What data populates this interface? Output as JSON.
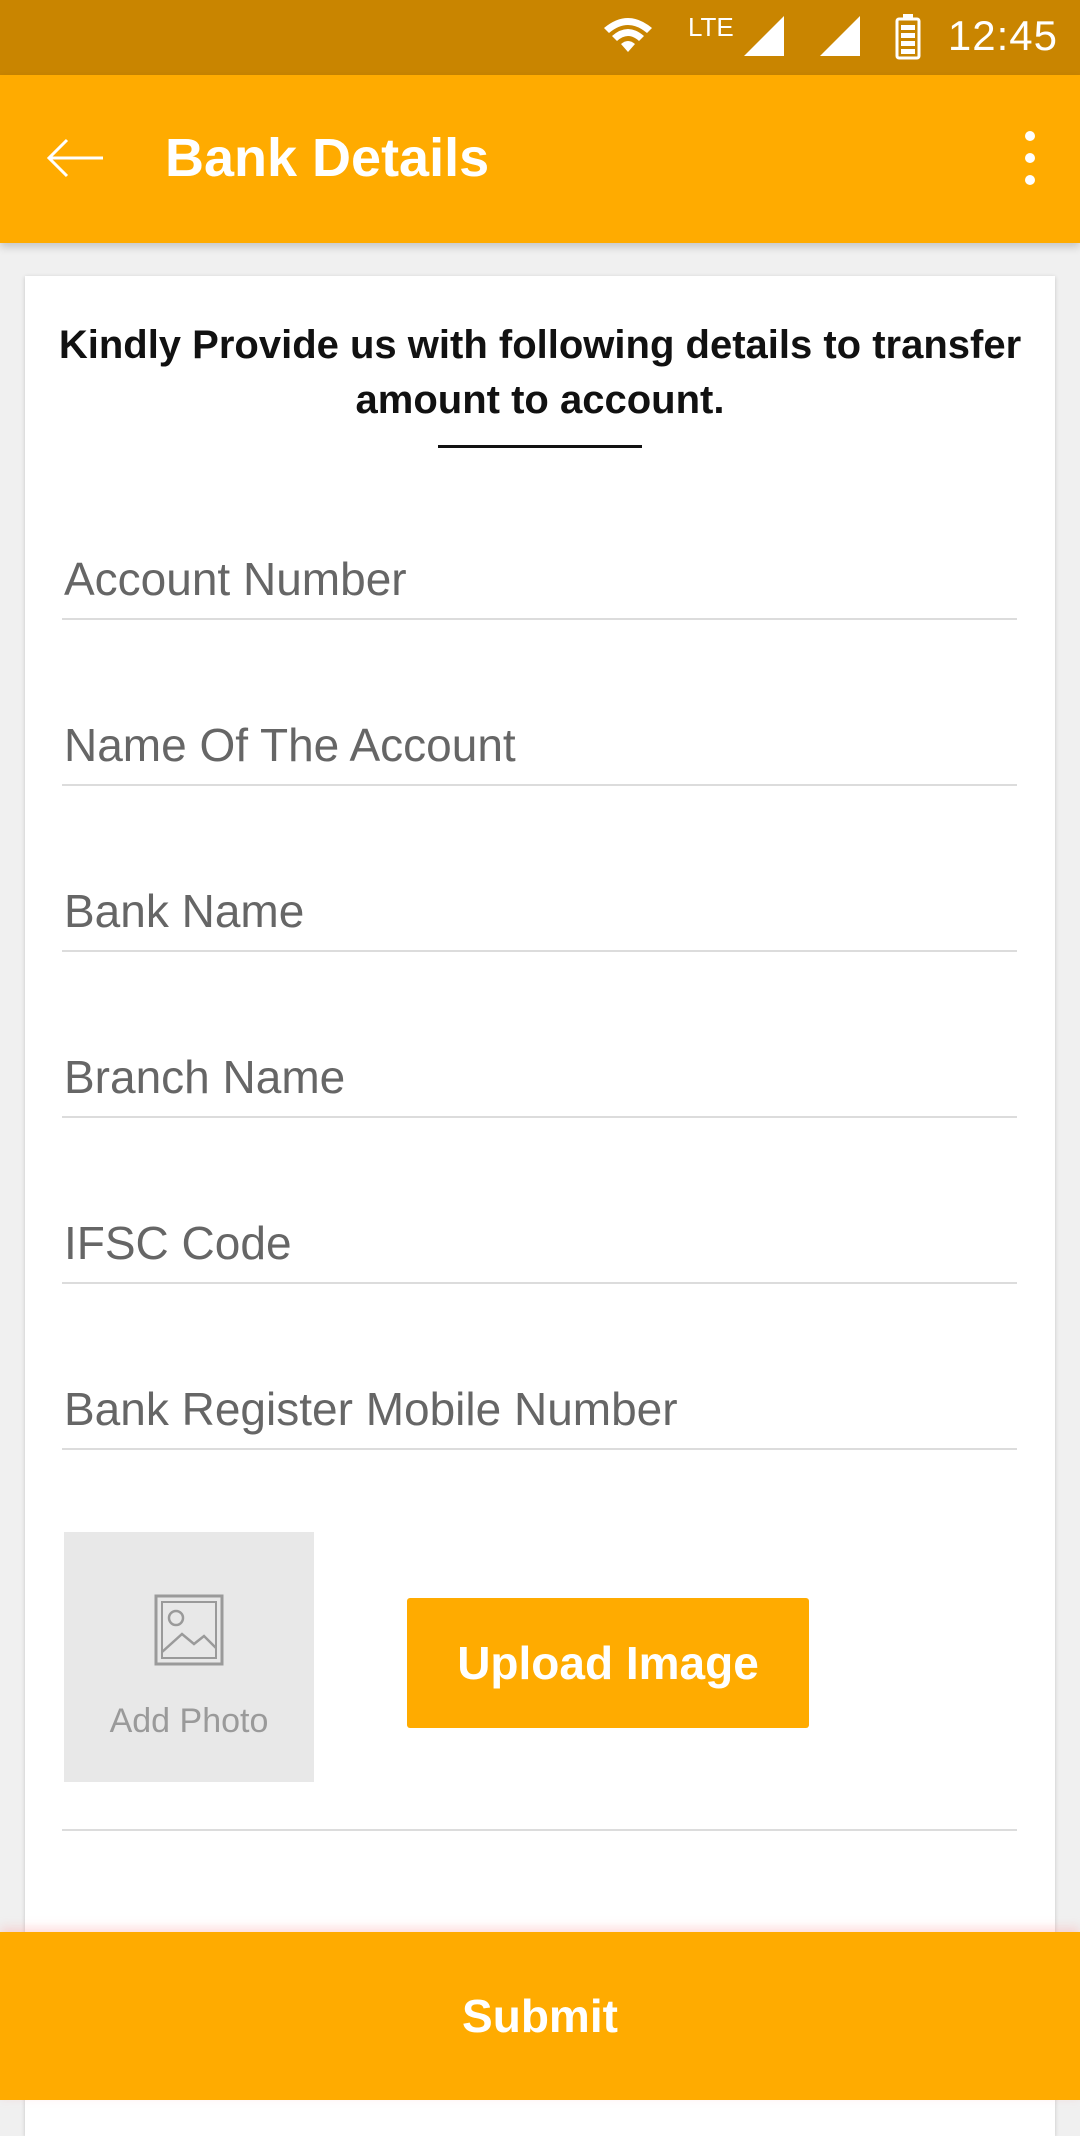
{
  "status_bar": {
    "time": "12:45",
    "network_label": "LTE",
    "icons": [
      "wifi-icon",
      "signal-icon",
      "signal-icon",
      "battery-icon"
    ]
  },
  "app_bar": {
    "title": "Bank Details",
    "back_icon": "arrow-left-icon",
    "menu_icon": "more-vertical-icon"
  },
  "form": {
    "intro": "Kindly Provide us with following details to transfer amount to account.",
    "fields": [
      {
        "placeholder": "Account Number",
        "value": ""
      },
      {
        "placeholder": "Name Of The Account",
        "value": ""
      },
      {
        "placeholder": "Bank Name",
        "value": ""
      },
      {
        "placeholder": "Branch Name",
        "value": ""
      },
      {
        "placeholder": "IFSC Code",
        "value": ""
      },
      {
        "placeholder": "Bank Register Mobile Number",
        "value": ""
      }
    ],
    "add_photo_label": "Add Photo",
    "upload_button_label": "Upload Image",
    "submit_label": "Submit"
  },
  "colors": {
    "status_bar": "#c98500",
    "accent": "#ffab00",
    "photo_placeholder_bg": "#e8e8e8"
  }
}
